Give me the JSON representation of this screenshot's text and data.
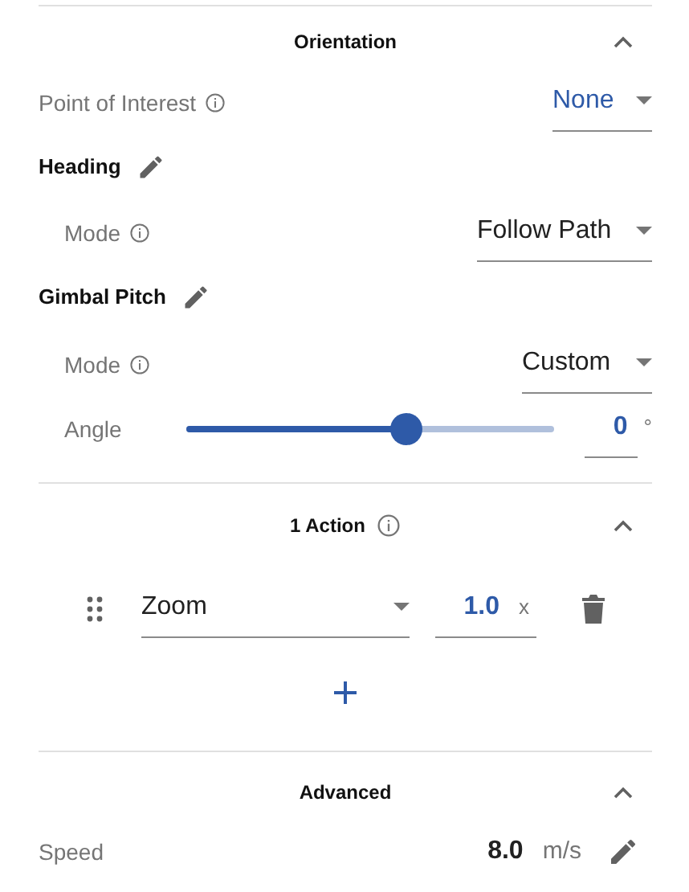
{
  "orientation": {
    "title": "Orientation",
    "expanded": true,
    "point_of_interest": {
      "label": "Point of Interest",
      "value": "None"
    },
    "heading": {
      "title": "Heading",
      "mode": {
        "label": "Mode",
        "value": "Follow Path"
      }
    },
    "gimbal_pitch": {
      "title": "Gimbal Pitch",
      "mode": {
        "label": "Mode",
        "value": "Custom"
      },
      "angle": {
        "label": "Angle",
        "level": 0.6,
        "value": "0",
        "unit": "°"
      }
    }
  },
  "actions": {
    "title": "1 Action",
    "expanded": true,
    "items": [
      {
        "type": "Zoom",
        "value": "1.0",
        "unit": "x"
      }
    ]
  },
  "advanced": {
    "title": "Advanced",
    "expanded": true,
    "speed": {
      "label": "Speed",
      "value": "8.0",
      "unit": "m/s"
    }
  }
}
